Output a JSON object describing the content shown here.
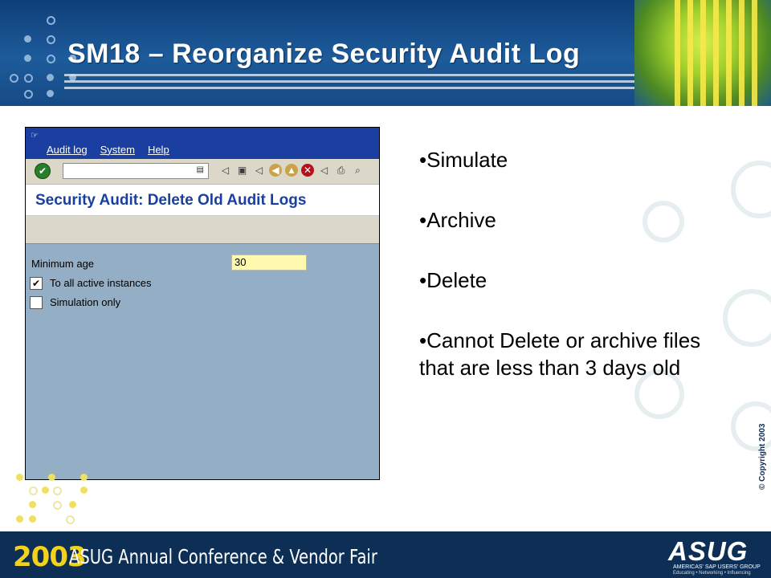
{
  "slide": {
    "title": "SM18 – Reorganize Security Audit Log",
    "bullets": [
      "•Simulate",
      "•Archive",
      "•Delete",
      "•Cannot Delete or archive files that are less than 3 days old"
    ],
    "footer": {
      "year": "2003",
      "conference": "ASUG Annual Conference & Vendor Fair",
      "logo": "ASUG",
      "logo_sub": "AMERICAS' SAP USERS' GROUP",
      "logo_tagline": "Educating • Networking • Influencing"
    },
    "copyright": "© Copyright 2003"
  },
  "sap_window": {
    "menu": [
      "Audit log",
      "System",
      "Help"
    ],
    "toolbar_icons": [
      "enter-icon",
      "save-icon",
      "back-icon",
      "exit-icon",
      "cancel-icon",
      "print-icon",
      "find-icon"
    ],
    "screen_title": "Security Audit: Delete Old Audit Logs",
    "fields": {
      "minimum_age_label": "Minimum age",
      "minimum_age_value": "30"
    },
    "checkboxes": [
      {
        "label": "To all active instances",
        "checked": true
      },
      {
        "label": "Simulation only",
        "checked": false
      }
    ]
  },
  "colors": {
    "header_blue": "#1d5b9b",
    "sap_title_blue": "#1a3fa0",
    "sap_background": "#93aec5",
    "input_yellow": "#fff9b0",
    "footer_navy": "#0d2f56",
    "year_gold": "#f2d21a"
  }
}
